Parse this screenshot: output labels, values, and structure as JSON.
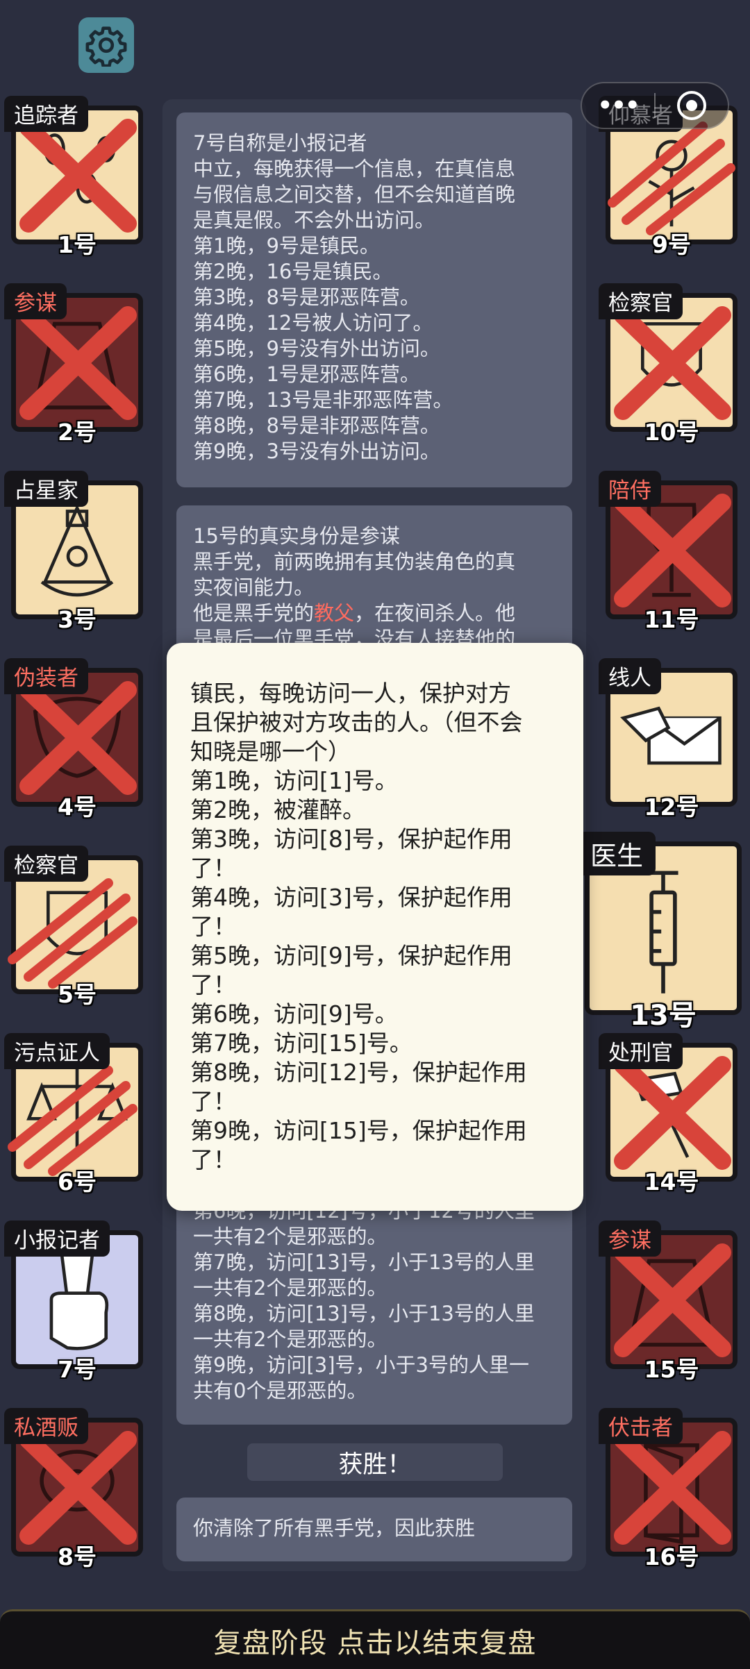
{
  "header": {
    "settings_icon": "gear-icon"
  },
  "mini_program_capsule": {
    "more_icon": "more-dots-icon",
    "close_icon": "target-circle-icon"
  },
  "players": [
    {
      "role": "追踪者",
      "number": "1号",
      "icon": "footprints-icon",
      "bg": "light",
      "mark": "x"
    },
    {
      "role": "参谋",
      "number": "2号",
      "icon": "robe-icon",
      "bg": "dark",
      "mark": "x",
      "tag_color": "red"
    },
    {
      "role": "占星家",
      "number": "3号",
      "icon": "sextant-icon",
      "bg": "light",
      "mark": "none"
    },
    {
      "role": "伪装者",
      "number": "4号",
      "icon": "mask-icon",
      "bg": "dark",
      "mark": "x",
      "tag_color": "red"
    },
    {
      "role": "检察官",
      "number": "5号",
      "icon": "badge-icon",
      "bg": "light",
      "mark": "claw"
    },
    {
      "role": "污点证人",
      "number": "6号",
      "icon": "scales-icon",
      "bg": "light",
      "mark": "claw"
    },
    {
      "role": "小报记者",
      "number": "7号",
      "icon": "newspaper-fist-icon",
      "bg": "blue",
      "mark": "none"
    },
    {
      "role": "私酒贩",
      "number": "8号",
      "icon": "bottle-icon",
      "bg": "dark",
      "mark": "x",
      "tag_color": "red"
    },
    {
      "role": "仰慕者",
      "number": "9号",
      "icon": "flower-icon",
      "bg": "light",
      "mark": "claw"
    },
    {
      "role": "检察官",
      "number": "10号",
      "icon": "badge-icon",
      "bg": "light",
      "mark": "x"
    },
    {
      "role": "陪侍",
      "number": "11号",
      "icon": "wineglass-icon",
      "bg": "dark",
      "mark": "x",
      "tag_color": "red"
    },
    {
      "role": "线人",
      "number": "12号",
      "icon": "envelope-hand-icon",
      "bg": "light",
      "mark": "none"
    },
    {
      "role": "医生",
      "number": "13号",
      "icon": "syringe-icon",
      "bg": "light",
      "mark": "none"
    },
    {
      "role": "处刑官",
      "number": "14号",
      "icon": "gavel-icon",
      "bg": "light",
      "mark": "x"
    },
    {
      "role": "参谋",
      "number": "15号",
      "icon": "robe-icon",
      "bg": "dark",
      "mark": "x",
      "tag_color": "red"
    },
    {
      "role": "伏击者",
      "number": "16号",
      "icon": "door-icon",
      "bg": "dark",
      "mark": "x",
      "tag_color": "red"
    }
  ],
  "log_panel_1": {
    "lines": [
      "7号自称是小报记者",
      "中立，每晚获得一个信息，在真信息",
      "与假信息之间交替，但不会知道首晚",
      "是真是假。不会外出访问。",
      "第1晚，9号是镇民。",
      "第2晚，16号是镇民。",
      "第3晚，8号是邪恶阵营。",
      "第4晚，12号被人访问了。",
      "第5晚，9号没有外出访问。",
      "第6晚，1号是邪恶阵营。",
      "第7晚，13号是非邪恶阵营。",
      "第8晚，8号是非邪恶阵营。",
      "第9晚，3号没有外出访问。"
    ]
  },
  "log_panel_2": {
    "line1": "15号的真实身份是参谋",
    "line2": "黑手党，前两晚拥有其伪装角色的真",
    "line3": "实夜间能力。",
    "line4_pre": "他是黑手党的",
    "line4_hl": "教父",
    "line4_post": "，在夜间杀人。他",
    "line5": "是最后一位黑手党，没有人接替他的"
  },
  "log_panel_3": {
    "lines": [
      "第6晚，访问[12]号，小于12号的人里",
      "一共有2个是邪恶的。",
      "第7晚，访问[13]号，小于13号的人里",
      "一共有2个是邪恶的。",
      "第8晚，访问[13]号，小于13号的人里",
      "一共有2个是邪恶的。",
      "第9晚，访问[3]号，小于3号的人里一",
      "共有0个是邪恶的。"
    ]
  },
  "victory": {
    "label": "获胜！",
    "message": "你清除了所有黑手党，因此获胜"
  },
  "popup": {
    "lines": [
      "镇民，每晚访问一人，保护对方",
      "且保护被对方攻击的人。（但不会",
      "知晓是哪一个）",
      "第1晚，访问[1]号。",
      "第2晚，被灌醉。",
      "第3晚，访问[8]号，保护起作用",
      "了！",
      "第4晚，访问[3]号，保护起作用",
      "了！",
      "第5晚，访问[9]号，保护起作用",
      "了！",
      "第6晚，访问[9]号。",
      "第7晚，访问[15]号。",
      "第8晚，访问[12]号，保护起作用",
      "了！",
      "第9晚，访问[15]号，保护起作用",
      "了！"
    ]
  },
  "bottom_bar": {
    "label": "复盘阶段 点击以结束复盘"
  },
  "colors": {
    "background": "#2b2e3f",
    "card_light": "#f5deb0",
    "card_dark": "#6b2829",
    "card_blue": "#cbcdee",
    "mark_red": "#d8443a",
    "highlight": "#ff6b5f",
    "popup_bg": "#fbf9ec",
    "bottom_text": "#f1e3b4"
  }
}
